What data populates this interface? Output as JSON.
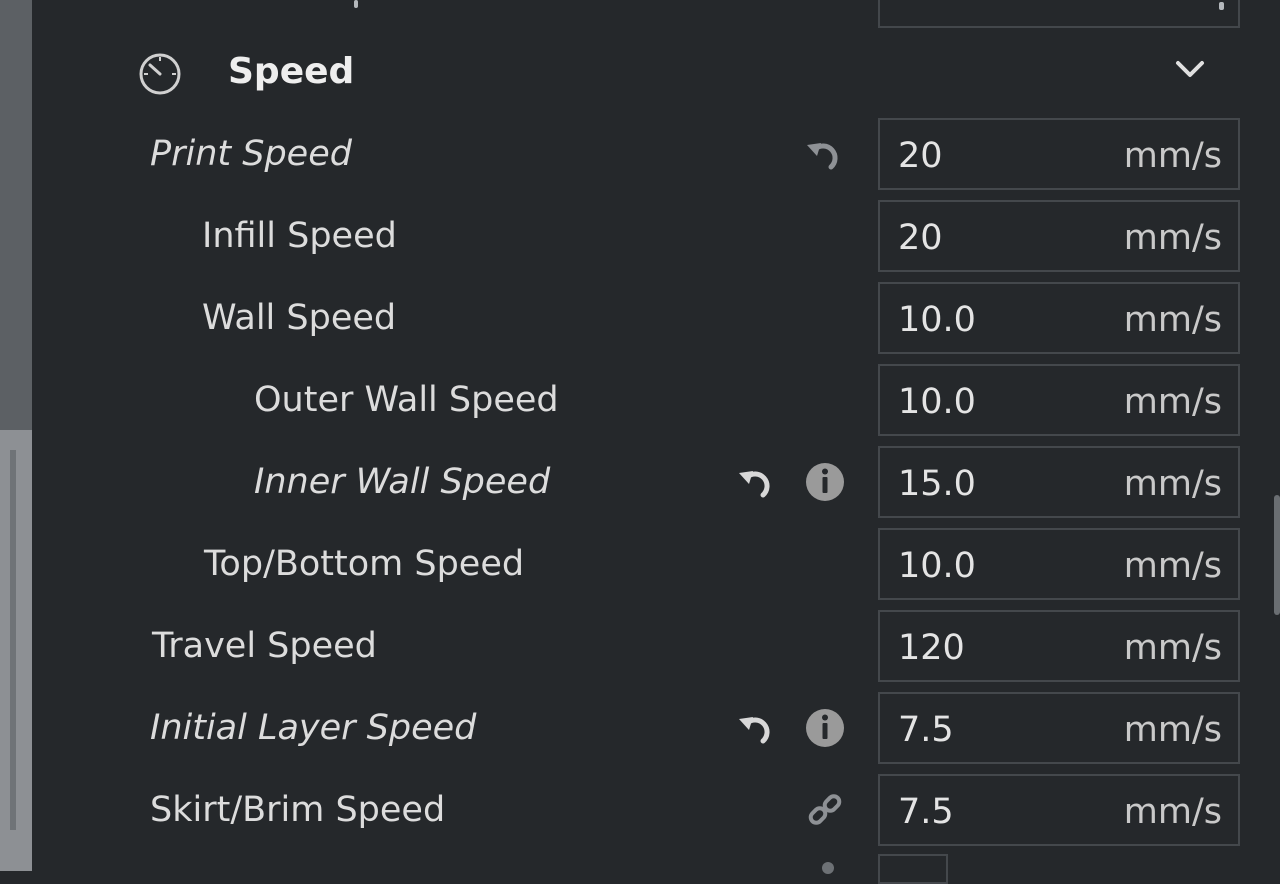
{
  "section": {
    "title": "Speed",
    "icon": "speedometer-icon",
    "collapse_icon": "chevron-down-icon"
  },
  "settings": [
    {
      "label": "Print Speed",
      "value": "20",
      "unit": "mm/s",
      "italic": true,
      "icons": [
        "reset-icon"
      ]
    },
    {
      "label": "Infill Speed",
      "value": "20",
      "unit": "mm/s",
      "italic": false,
      "icons": []
    },
    {
      "label": "Wall Speed",
      "value": "10.0",
      "unit": "mm/s",
      "italic": false,
      "icons": []
    },
    {
      "label": "Outer Wall Speed",
      "value": "10.0",
      "unit": "mm/s",
      "italic": false,
      "icons": []
    },
    {
      "label": "Inner Wall Speed",
      "value": "15.0",
      "unit": "mm/s",
      "italic": true,
      "icons": [
        "reset-icon",
        "info-icon"
      ]
    },
    {
      "label": "Top/Bottom Speed",
      "value": "10.0",
      "unit": "mm/s",
      "italic": false,
      "icons": []
    },
    {
      "label": "Travel Speed",
      "value": "120",
      "unit": "mm/s",
      "italic": false,
      "icons": []
    },
    {
      "label": "Initial Layer Speed",
      "value": "7.5",
      "unit": "mm/s",
      "italic": true,
      "icons": [
        "reset-icon",
        "info-icon"
      ]
    },
    {
      "label": "Skirt/Brim Speed",
      "value": "7.5",
      "unit": "mm/s",
      "italic": false,
      "icons": [
        "link-icon"
      ]
    }
  ],
  "colors": {
    "panel_background": "#25282b",
    "field_border": "#44484c",
    "text": "#dcdcdc",
    "icon": "#c8c8c8",
    "info_icon": "#9a9a9a"
  }
}
